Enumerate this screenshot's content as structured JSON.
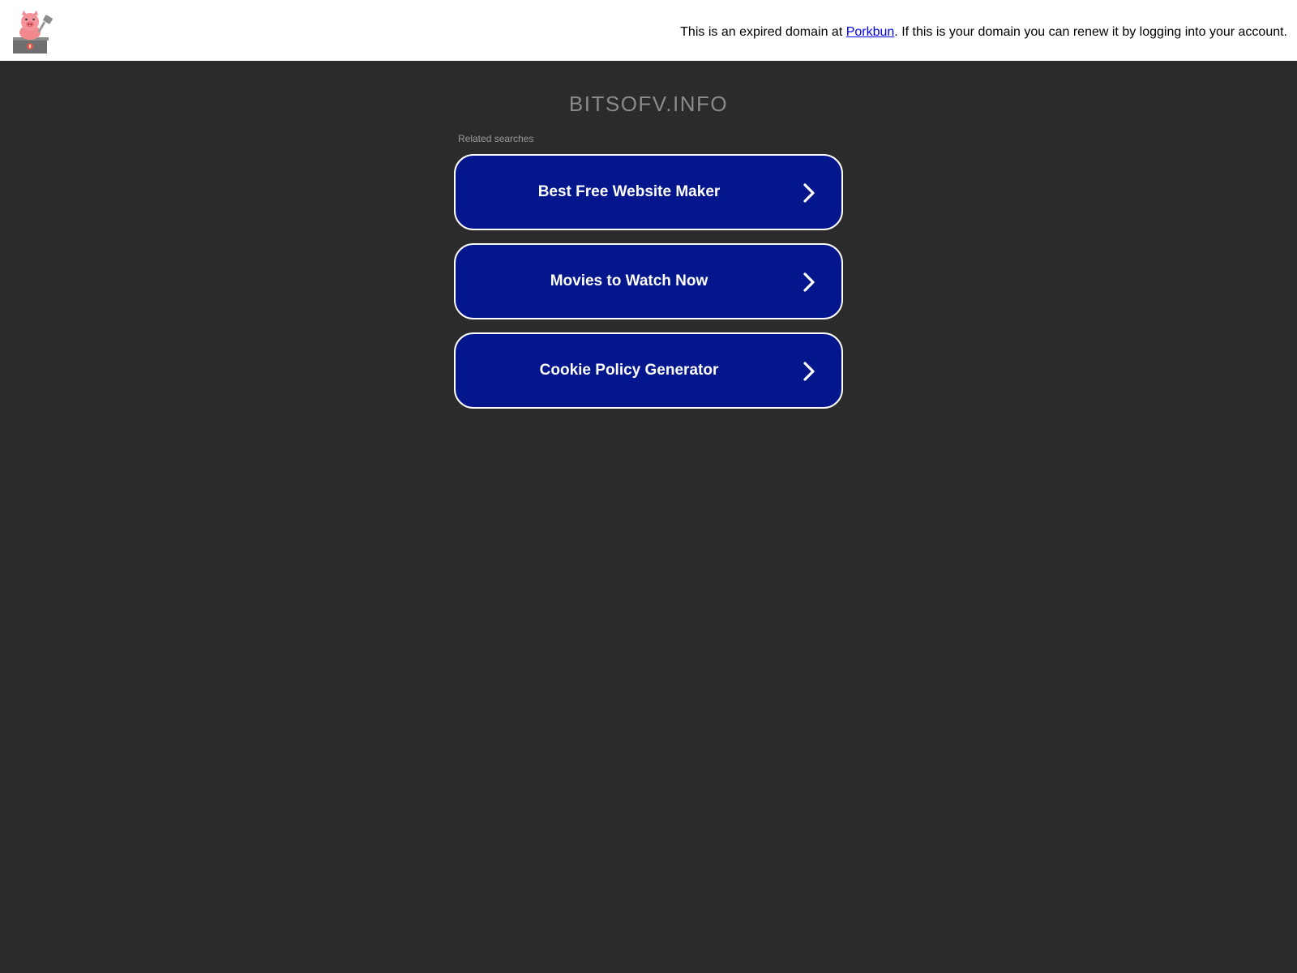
{
  "banner": {
    "notice_prefix": "This is an expired domain at ",
    "registrar_link": "Porkbun",
    "notice_suffix": ". If this is your domain you can renew it by logging into your account."
  },
  "main": {
    "domain_name": "BITSOFV.INFO",
    "related_label": "Related searches",
    "searches": [
      {
        "label": "Best Free Website Maker"
      },
      {
        "label": "Movies to Watch Now"
      },
      {
        "label": "Cookie Policy Generator"
      }
    ]
  },
  "colors": {
    "background": "#2b2b2b",
    "button": "#03168c",
    "link": "#0000ee"
  }
}
